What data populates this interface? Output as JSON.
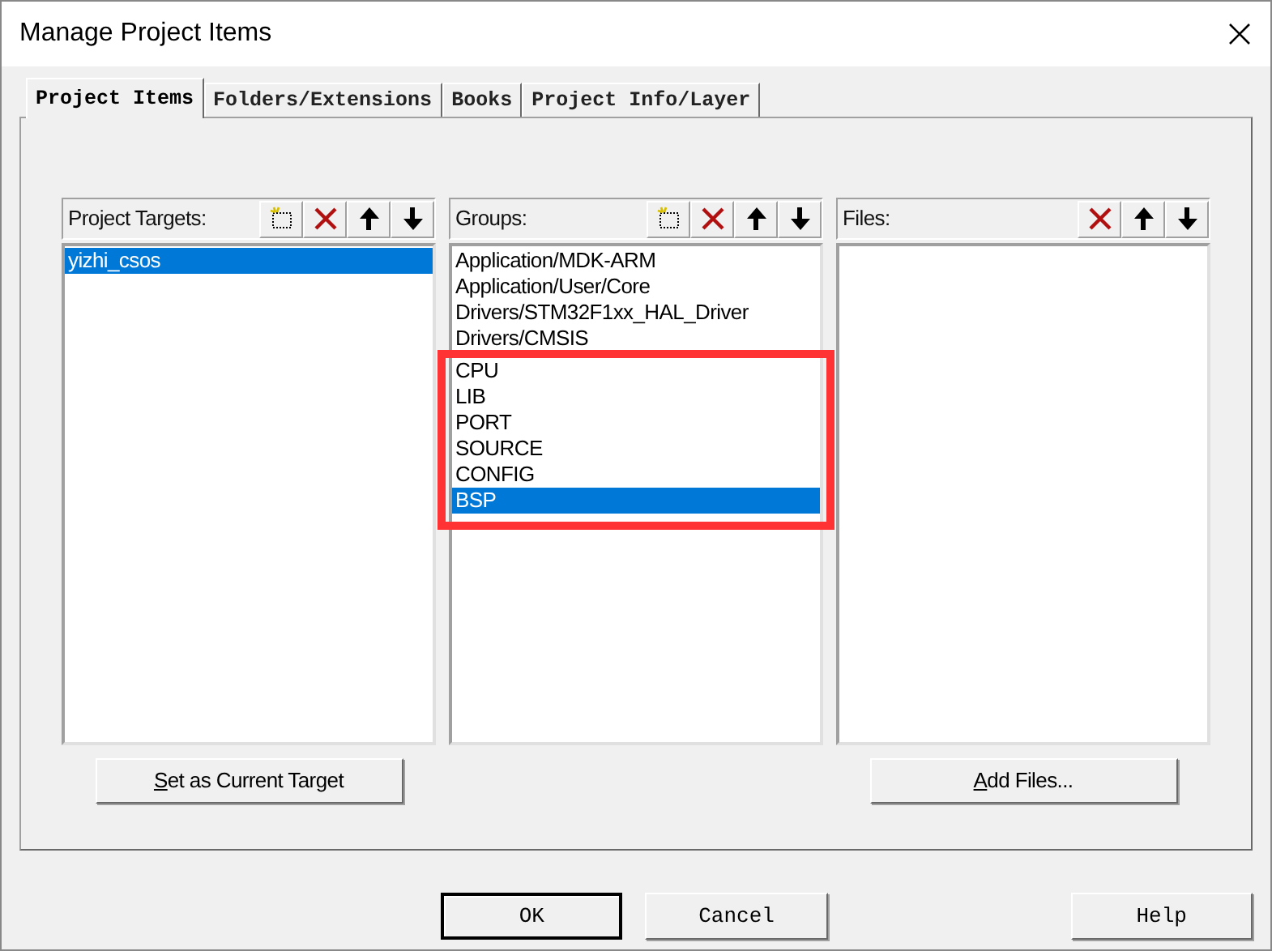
{
  "window": {
    "title": "Manage Project Items"
  },
  "tabs": [
    {
      "label": "Project Items",
      "selected": true
    },
    {
      "label": "Folders/Extensions",
      "selected": false
    },
    {
      "label": "Books",
      "selected": false
    },
    {
      "label": "Project Info/Layer",
      "selected": false
    }
  ],
  "panels": [
    {
      "label": "Project Targets:",
      "tools": [
        {
          "kind": "new"
        },
        {
          "kind": "delete"
        },
        {
          "kind": "up"
        },
        {
          "kind": "down"
        }
      ],
      "button": {
        "label": "Set as Current Target",
        "mnemonic": true
      },
      "items": [
        {
          "text": "yizhi_csos",
          "selected": true,
          "highlighted": false
        }
      ]
    },
    {
      "label": "Groups:",
      "tools": [
        {
          "kind": "new"
        },
        {
          "kind": "delete"
        },
        {
          "kind": "up"
        },
        {
          "kind": "down"
        }
      ],
      "items": [
        {
          "text": "Application/MDK-ARM",
          "selected": false,
          "highlighted": false
        },
        {
          "text": "Application/User/Core",
          "selected": false,
          "highlighted": false
        },
        {
          "text": "Drivers/STM32F1xx_HAL_Driver",
          "selected": false,
          "highlighted": false
        },
        {
          "text": "Drivers/CMSIS",
          "selected": false,
          "highlighted": false
        },
        {
          "text": "CPU",
          "selected": false,
          "highlighted": true
        },
        {
          "text": "LIB",
          "selected": false,
          "highlighted": true
        },
        {
          "text": "PORT",
          "selected": false,
          "highlighted": true
        },
        {
          "text": "SOURCE",
          "selected": false,
          "highlighted": true
        },
        {
          "text": "CONFIG",
          "selected": false,
          "highlighted": true
        },
        {
          "text": "BSP",
          "selected": true,
          "highlighted": true
        }
      ]
    },
    {
      "label": "Files:",
      "tools": [
        {
          "kind": "delete"
        },
        {
          "kind": "up"
        },
        {
          "kind": "down"
        }
      ],
      "button": {
        "label": "Add Files...",
        "mnemonic": true
      }
    }
  ],
  "dialog_buttons": [
    {
      "label": "OK",
      "default": true
    },
    {
      "label": "Cancel",
      "default": false
    },
    {
      "label": "Help",
      "default": false
    }
  ]
}
